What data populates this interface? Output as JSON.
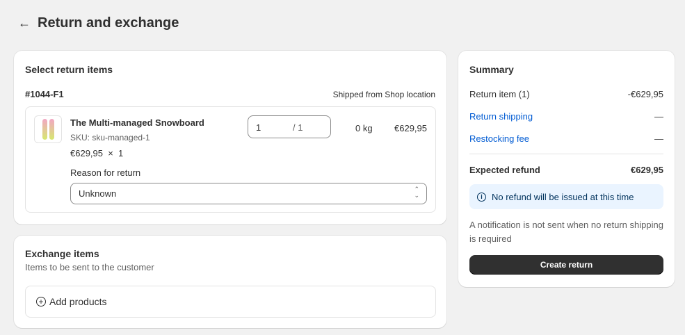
{
  "header": {
    "back_icon": "arrow-left-icon",
    "title": "Return and exchange"
  },
  "select": {
    "title": "Select return items",
    "order": "#1044-F1",
    "shipped_from": "Shipped from Shop location",
    "item": {
      "name": "The Multi-managed Snowboard",
      "sku": "SKU: sku-managed-1",
      "price_qty": "€629,95  ×  1",
      "qty_value": "1",
      "qty_max": "/ 1",
      "weight": "0 kg",
      "total": "€629,95",
      "reason_label": "Reason for return",
      "reason_value": "Unknown"
    }
  },
  "exchange": {
    "title": "Exchange items",
    "subtitle": "Items to be sent to the customer",
    "add_label": "Add products"
  },
  "summary": {
    "title": "Summary",
    "return_item_label": "Return item (1)",
    "return_item_value": "-€629,95",
    "shipping_label": "Return shipping",
    "shipping_value": "—",
    "restock_label": "Restocking fee",
    "restock_value": "—",
    "refund_label": "Expected refund",
    "refund_value": "€629,95",
    "banner": "No refund will be issued at this time",
    "note": "A notification is not sent when no return shipping is required",
    "create_label": "Create return"
  }
}
